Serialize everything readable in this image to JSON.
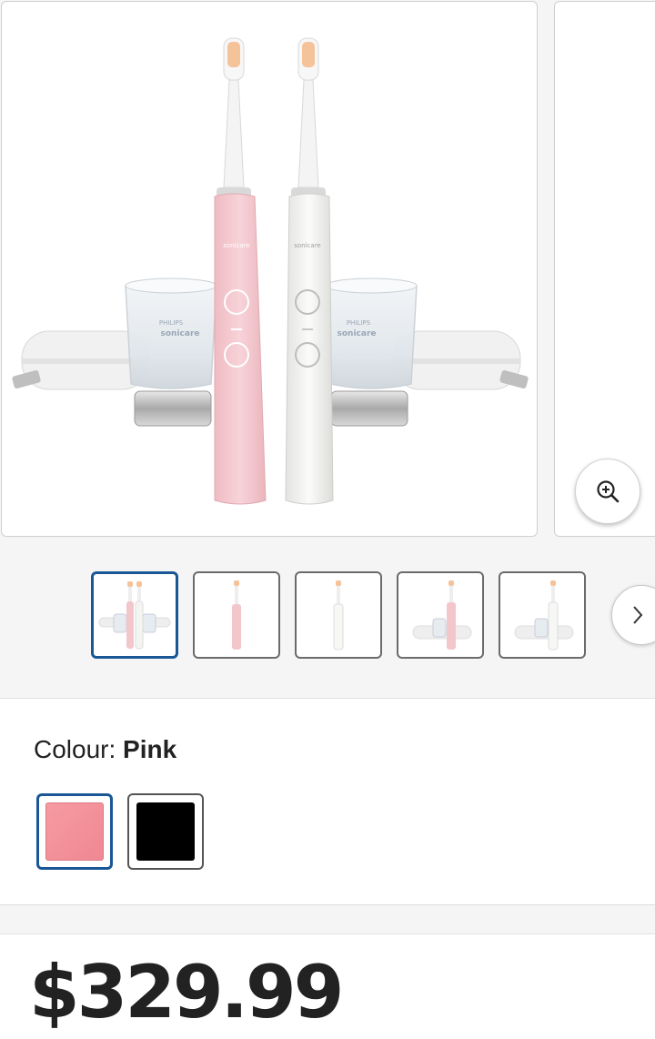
{
  "gallery": {
    "main_image_alt": "Philips Sonicare DiamondClean toothbrushes pink and white with charging glasses and travel cases",
    "brand_text": "PHILIPS",
    "product_text": "sonicare",
    "zoom_icon": "zoom-in-icon"
  },
  "thumbnails": {
    "items": [
      {
        "label": "pair-with-accessories",
        "selected": true
      },
      {
        "label": "pink-handle",
        "selected": false
      },
      {
        "label": "white-handle",
        "selected": false
      },
      {
        "label": "pink-with-glass-and-case",
        "selected": false
      },
      {
        "label": "white-with-glass-and-case",
        "selected": false
      }
    ],
    "next_icon": "chevron-right-icon"
  },
  "colour": {
    "prefix": "Colour: ",
    "selected_name": "Pink",
    "swatches": [
      {
        "name": "Pink",
        "color": "#f4929b",
        "selected": true
      },
      {
        "name": "Black",
        "color": "#000000",
        "selected": false
      }
    ]
  },
  "price": {
    "value": "$329.99"
  },
  "colors": {
    "accent": "#1a5796",
    "pink": "#f4929b",
    "pink_handle": "#f3c6cc",
    "white_handle": "#f4f4f2"
  }
}
